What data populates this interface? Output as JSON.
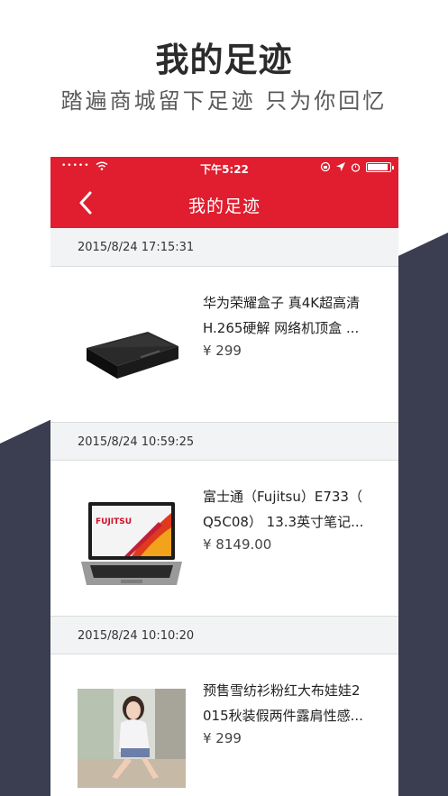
{
  "promo": {
    "title": "我的足迹",
    "subtitle": "踏遍商城留下足迹 只为你回忆"
  },
  "colors": {
    "brand_red": "#e01e2f",
    "dark_slate": "#3a3e50",
    "date_header_bg": "#f2f3f5"
  },
  "status_bar": {
    "signal": "•••••",
    "time": "下午5:22",
    "battery_level": 0.9
  },
  "nav": {
    "back_icon": "chevron-left-icon",
    "title": "我的足迹"
  },
  "history": [
    {
      "date": "2015/8/24 17:15:31",
      "name_line1": "华为荣耀盒子 真4K超高清",
      "name_line2": "H.265硬解 网络机顶盒 ...",
      "price": "¥ 299",
      "image": "tv-box-image"
    },
    {
      "date": "2015/8/24 10:59:25",
      "name_line1": "富士通（Fujitsu）E733（",
      "name_line2": "Q5C08） 13.3英寸笔记...",
      "price": "¥ 8149.00",
      "image": "laptop-image",
      "screen_brand": "FUJITSU"
    },
    {
      "date": "2015/8/24 10:10:20",
      "name_line1": "预售雪纺衫粉红大布娃娃2",
      "name_line2": "015秋装假两件露肩性感...",
      "price": "¥ 299",
      "image": "fashion-model-image"
    }
  ]
}
